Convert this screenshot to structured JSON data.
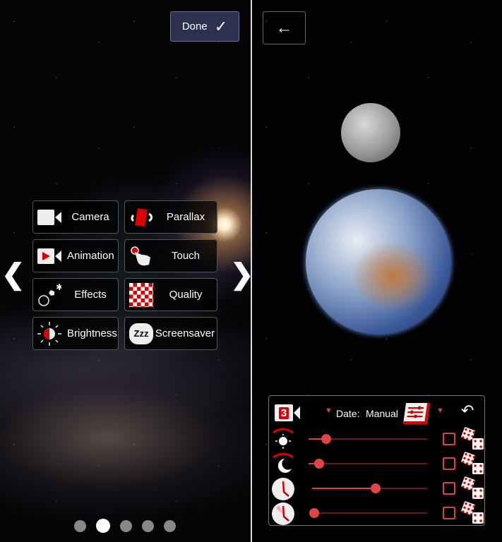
{
  "left_panel": {
    "done_label": "Done",
    "tiles": [
      {
        "label": "Camera",
        "icon": "video-camera-icon"
      },
      {
        "label": "Parallax",
        "icon": "parallax-rotate-icon"
      },
      {
        "label": "Animation",
        "icon": "animation-play-camera-icon"
      },
      {
        "label": "Touch",
        "icon": "touch-hand-icon"
      },
      {
        "label": "Effects",
        "icon": "effects-sparkle-icon"
      },
      {
        "label": "Quality",
        "icon": "quality-checker-icon"
      },
      {
        "label": "Brightness",
        "icon": "brightness-icon"
      },
      {
        "label": "Screensaver",
        "icon": "zzz-sleep-icon"
      }
    ],
    "page_count": 5,
    "active_page": 2
  },
  "right_panel": {
    "controls": {
      "camera_number": "3",
      "date_label": "Date:",
      "date_value": "Manual",
      "sliders": [
        {
          "name": "sun-brightness",
          "value": 0.15,
          "checked": false
        },
        {
          "name": "moon-brightness",
          "value": 0.09,
          "checked": false
        },
        {
          "name": "time",
          "value": 0.55,
          "checked": false
        },
        {
          "name": "time-speed",
          "value": 0.02,
          "checked": false
        }
      ]
    }
  },
  "colors": {
    "accent": "#d94040",
    "done_bg": "#2c3150"
  }
}
